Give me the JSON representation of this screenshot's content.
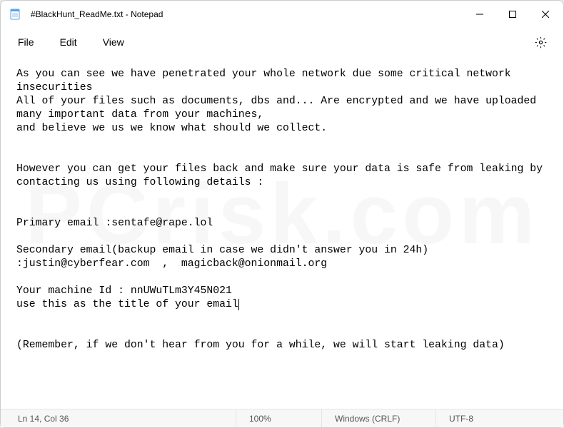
{
  "titlebar": {
    "title": "#BlackHunt_ReadMe.txt - Notepad"
  },
  "menu": {
    "file": "File",
    "edit": "Edit",
    "view": "View"
  },
  "body_text": {
    "p1": "As you can see we have penetrated your whole network due some critical network insecurities",
    "p2": "All of your files such as documents, dbs and... Are encrypted and we have uploaded many important data from your machines,",
    "p3": "and believe we us we know what should we collect.",
    "blank1": "",
    "blank2": "",
    "p4": "However you can get your files back and make sure your data is safe from leaking by contacting us using following details :",
    "blank3": "",
    "blank4": "",
    "p5": "Primary email :sentafe@rape.lol",
    "blank5": "",
    "p6": "Secondary email(backup email in case we didn't answer you in 24h) :justin@cyberfear.com  ,  magicback@onionmail.org",
    "blank6": "",
    "p7": "Your machine Id : nnUWuTLm3Y45N021",
    "p8": "use this as the title of your email",
    "blank7": "",
    "blank8": "",
    "p9": "(Remember, if we don't hear from you for a while, we will start leaking data)"
  },
  "status": {
    "cursor": "Ln 14, Col 36",
    "zoom": "100%",
    "eol": "Windows (CRLF)",
    "encoding": "UTF-8"
  }
}
